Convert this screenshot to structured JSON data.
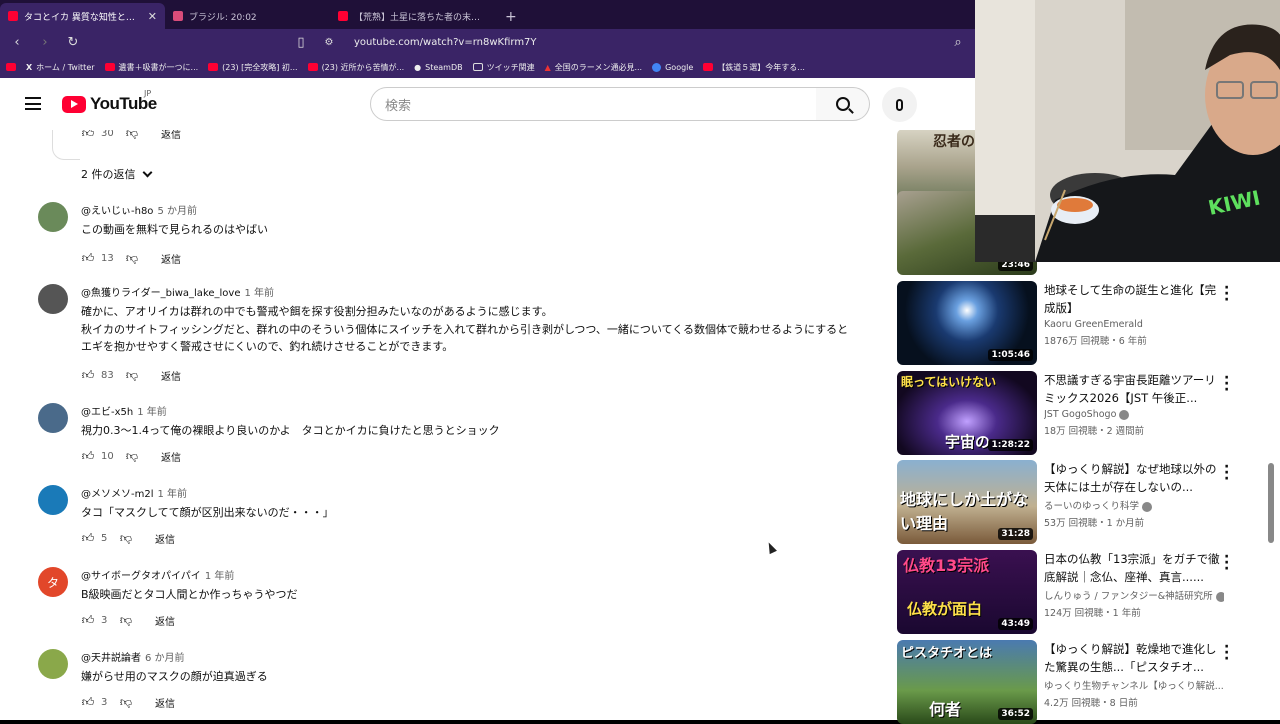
{
  "tabs": [
    {
      "title": "タコとイカ 異質な知性と体に秘めら",
      "active": true
    },
    {
      "title": "ブラジル: 20:02",
      "active": false
    },
    {
      "title": "【荒熟】土星に落ちた者の末路...... - You",
      "active": false
    }
  ],
  "nav": {
    "url": "youtube.com/watch?v=rn8wKfirm7Y"
  },
  "bookmarks": [
    {
      "label": "ホーム / Twitter",
      "icon": "x"
    },
    {
      "label": "遺書＋吸書が一つに...",
      "icon": "yt"
    },
    {
      "label": "(23) [完全攻略] 初...",
      "icon": "yt"
    },
    {
      "label": "(23) 近所から苦情が...",
      "icon": "yt"
    },
    {
      "label": "SteamDB",
      "icon": "yt"
    },
    {
      "label": "ツイッチ関連",
      "icon": "folder"
    },
    {
      "label": "全国のラーメン通必見...",
      "icon": "yt"
    },
    {
      "label": "Google",
      "icon": "google"
    },
    {
      "label": "【鉄道５選】今年する...",
      "icon": "yt"
    }
  ],
  "header": {
    "logo": "YouTube",
    "region": "JP",
    "search_placeholder": "検索"
  },
  "comments": {
    "top_reply": {
      "likes": "30",
      "reply": "返信"
    },
    "replies_toggle": "2 件の返信",
    "items": [
      {
        "author": "@えいじぃ-h8o",
        "time": "5 か月前",
        "text": "この動画を無料で見られるのはやばい",
        "likes": "13",
        "reply": "返信",
        "avatar": "#6a8a5a"
      },
      {
        "author": "@魚獲りライダー_biwa_lake_love",
        "time": "1 年前",
        "text": "確かに、アオリイカは群れの中でも警戒や餌を探す役割分担みたいなのがあるように感じます。\n秋イカのサイトフィッシングだと、群れの中のそういう個体にスイッチを入れて群れから引き剥がしつつ、一緒についてくる数個体で競わせるようにすると\nエギを抱かせやすく警戒させにくいので、釣れ続けさせることができます。",
        "likes": "83",
        "reply": "返信",
        "avatar": "#555"
      },
      {
        "author": "@エビ-x5h",
        "time": "1 年前",
        "text": "視力0.3〜1.4って俺の裸眼より良いのかよ　タコとかイカに負けたと思うとショック",
        "likes": "10",
        "reply": "返信",
        "avatar": "#4a6a8a"
      },
      {
        "author": "@メソメソ-m2l",
        "time": "1 年前",
        "text": "タコ「マスクしてて顔が区別出来ないのだ・・・」",
        "likes": "5",
        "reply": "返信",
        "avatar": "#1a7ab8"
      },
      {
        "author": "@サイボーグタオパイパイ",
        "time": "1 年前",
        "text": "B級映画だとタコ人間とか作っちゃうやつだ",
        "likes": "3",
        "reply": "返信",
        "avatar": "#e2472a",
        "initial": "タ"
      },
      {
        "author": "@天井説論者",
        "time": "6 か月前",
        "text": "嫌がらせ用のマスクの顔が迫真過ぎる",
        "likes": "3",
        "reply": "返信",
        "avatar": "#8aa84a"
      }
    ]
  },
  "sidebar": [
    {
      "title": "",
      "channel": "",
      "stats": "",
      "duration": "",
      "thumb_text": "忍者の",
      "color": "#5a6b4a"
    },
    {
      "title": "",
      "channel": "",
      "stats": "",
      "duration": "23:46",
      "thumb_text": "",
      "color": "#3a4a2a"
    },
    {
      "title": "地球そして生命の誕生と進化【完成版】",
      "channel": "Kaoru GreenEmerald",
      "stats": "1876万 回視聴・6 年前",
      "duration": "1:05:46",
      "thumb_text": "",
      "color": "#0a1830"
    },
    {
      "title": "不思議すぎる宇宙長距離ツアーリミックス2026【JST 午後正...",
      "channel": "JST GogoShogo",
      "stats": "18万 回視聴・2 週間前",
      "duration": "1:28:22",
      "thumb_text": "眠ってはいけない",
      "thumb_text2": "宇宙の",
      "color": "#1a1030"
    },
    {
      "title": "【ゆっくり解説】なぜ地球以外の天体には土が存在しないの...",
      "channel": "るーいのゆっくり科学",
      "stats": "53万 回視聴・1 か月前",
      "duration": "31:28",
      "thumb_text": "地球にしか土がない理由",
      "color": "#6a8aa8"
    },
    {
      "title": "日本の仏教「13宗派」をガチで徹底解説｜念仏、座禅、真言......",
      "channel": "しんりゅう / ファンタジー&神話研究所",
      "stats": "124万 回視聴・1 年前",
      "duration": "43:49",
      "thumb_text": "仏教13宗派",
      "thumb_text2": "仏教が面白",
      "color": "#2a1040"
    },
    {
      "title": "【ゆっくり解説】乾燥地で進化した驚異の生態...「ピスタチオ...",
      "channel": "ゆっくり生物チャンネル【ゆっくり解説...",
      "stats": "4.2万 回視聴・8 日前",
      "duration": "36:52",
      "thumb_text": "ピスタチオとは",
      "thumb_text2": "何者",
      "color": "#3a5a8a"
    }
  ]
}
